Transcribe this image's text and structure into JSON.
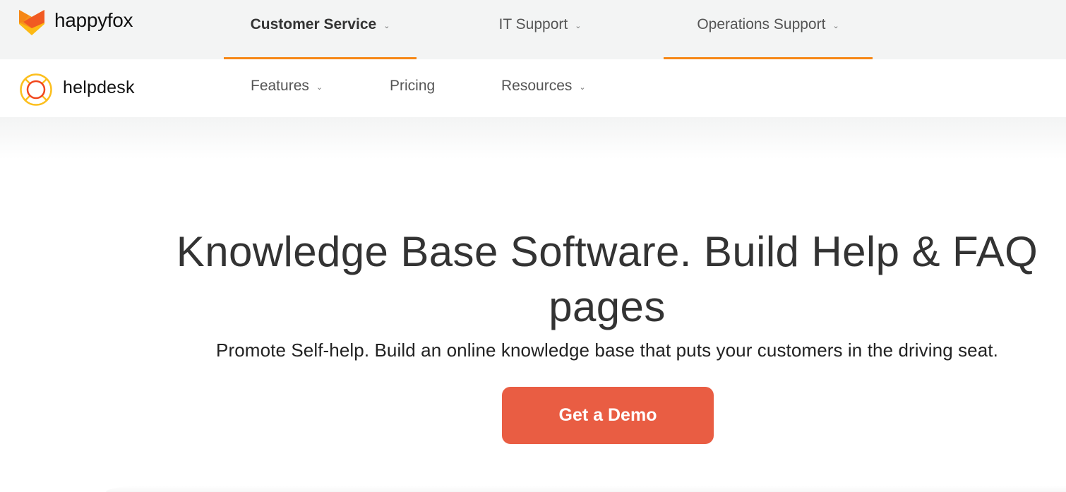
{
  "brand": {
    "name": "happyfox",
    "logo_icon": "fox-logo-icon",
    "colors": {
      "fox_dark": "#f15a22",
      "fox_mid": "#f7941d",
      "fox_light": "#fdb913"
    }
  },
  "product_tabs": [
    {
      "label": "Customer Service",
      "active": true,
      "has_dropdown": true
    },
    {
      "label": "IT Support",
      "active": false,
      "has_dropdown": true
    },
    {
      "label": "Operations Support",
      "active": false,
      "has_dropdown": true
    }
  ],
  "sub_brand": {
    "name": "helpdesk",
    "logo_icon": "lifebuoy-icon"
  },
  "sub_nav": [
    {
      "label": "Features",
      "has_dropdown": true
    },
    {
      "label": "Pricing",
      "has_dropdown": false
    },
    {
      "label": "Resources",
      "has_dropdown": true
    }
  ],
  "hero": {
    "title": "Knowledge Base Software. Build Help & FAQ pages",
    "subtitle": "Promote Self-help. Build an online knowledge base that puts your customers in the driving seat.",
    "cta_label": "Get a Demo"
  },
  "icons": {
    "dropdown": "⌄"
  },
  "colors": {
    "accent_underline": "#f68716",
    "cta_background": "#e95d43",
    "topbar_background": "#f3f4f4",
    "text_primary": "#333333"
  }
}
